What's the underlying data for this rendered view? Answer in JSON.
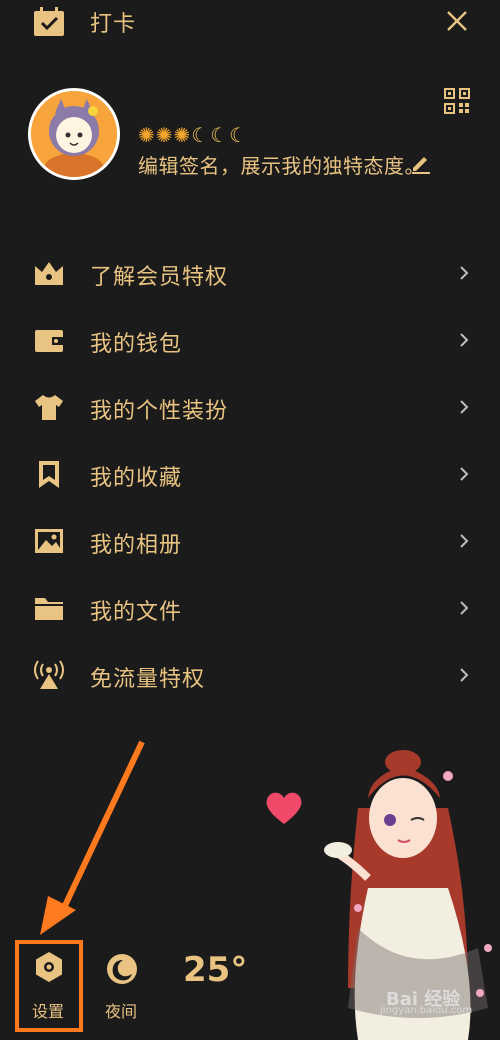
{
  "topbar": {
    "checkin_label": "打卡"
  },
  "profile": {
    "level_icons": [
      "sun",
      "sun",
      "sun",
      "moon",
      "moon",
      "moon"
    ],
    "signature": "编辑签名，展示我的独特态度。"
  },
  "menu": [
    {
      "label": "了解会员特权",
      "icon": "crown-icon"
    },
    {
      "label": "我的钱包",
      "icon": "wallet-icon"
    },
    {
      "label": "我的个性装扮",
      "icon": "shirt-icon"
    },
    {
      "label": "我的收藏",
      "icon": "bookmark-icon"
    },
    {
      "label": "我的相册",
      "icon": "image-icon"
    },
    {
      "label": "我的文件",
      "icon": "folder-icon"
    },
    {
      "label": "免流量特权",
      "icon": "signal-tower-icon"
    }
  ],
  "bottom": {
    "settings_label": "设置",
    "night_label": "夜间",
    "temperature": "25°"
  },
  "watermark": {
    "brand": "Bai 经验",
    "url": "jingyan.baidu.com"
  },
  "colors": {
    "accent": "#e8c382",
    "background": "#1b1b1b",
    "highlight": "#ff7a1f",
    "heart": "#f0496a"
  }
}
